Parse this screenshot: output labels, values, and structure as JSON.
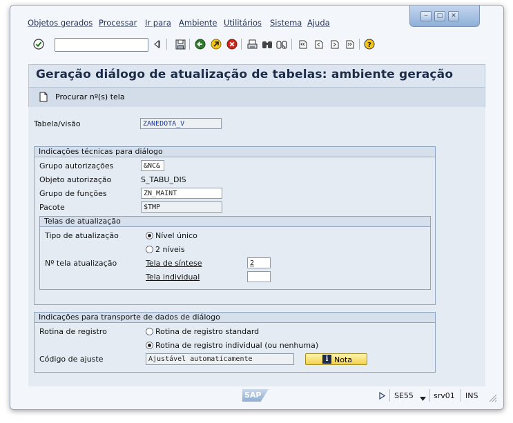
{
  "menu": {
    "items": [
      "Objetos gerados",
      "Processar",
      "Ir para",
      "Ambiente",
      "Utilitários",
      "Sistema",
      "Ajuda"
    ]
  },
  "toolbar": {
    "command_value": ""
  },
  "header": {
    "title": "Geração diálogo de atualização de tabelas: ambiente geração",
    "action_label": "Procurar nº(s) tela"
  },
  "main": {
    "table_label": "Tabela/visão",
    "table_value": "ZANEDOTA_V",
    "tech_group": {
      "title": "Indicações técnicas para diálogo",
      "auth_group_label": "Grupo autorizações",
      "auth_group_value": "&NC&",
      "auth_object_label": "Objeto autorização",
      "auth_object_value": "S_TABU_DIS",
      "function_group_label": "Grupo de funções",
      "function_group_value": "ZN_MAINT",
      "package_label": "Pacote",
      "package_value": "$TMP"
    },
    "screens_group": {
      "title": "Telas de atualização",
      "type_label": "Tipo de atualização",
      "option_single": "Nível único",
      "option_two": "2 níveis",
      "screen_no_label": "Nº tela atualização",
      "overview_label": "Tela de síntese",
      "overview_value": "2",
      "single_label": "Tela individual",
      "single_value": ""
    },
    "transport_group": {
      "title": "Indicações para transporte de dados de diálogo",
      "routine_label": "Rotina de registro",
      "option_standard": "Rotina de registro standard",
      "option_individual": "Rotina de registro individual (ou nenhuma)",
      "adjust_label": "Código de ajuste",
      "adjust_value": "Ajustável automaticamente",
      "note_button": "Nota"
    }
  },
  "status_bar": {
    "logo": "SAP",
    "transaction": "SE55",
    "server": "srv01",
    "mode": "INS"
  },
  "colors": {
    "window_bg": "#f3f6fa",
    "content_bg": "#e4ebf3",
    "title_bg": "#dde6f0",
    "note_button": "#f1d24a",
    "field_text_blue": "#1a3aa8"
  }
}
